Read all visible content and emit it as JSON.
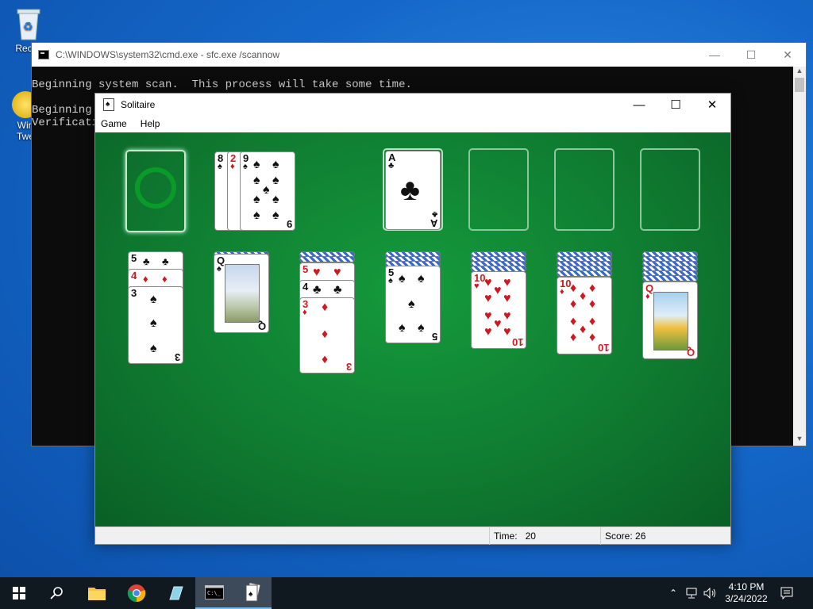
{
  "desktop": {
    "recycle_label": "Recyc",
    "tweaker_label_1": "Win",
    "tweaker_label_2": "Twe"
  },
  "cmd": {
    "title": "C:\\WINDOWS\\system32\\cmd.exe - sfc.exe /scannow",
    "lines": [
      "Beginning system scan.  This process will take some time.",
      "",
      "Beginning",
      "Verificati"
    ]
  },
  "solitaire": {
    "title": "Solitaire",
    "menu": [
      "Game",
      "Help"
    ],
    "status": {
      "time_label": "Time:",
      "time_value": "20",
      "score_label": "Score: 26"
    },
    "waste": [
      {
        "rank": "8",
        "suit": "♠",
        "color": "blk"
      },
      {
        "rank": "2",
        "suit": "♦",
        "color": "red"
      },
      {
        "rank": "9",
        "suit": "♠",
        "color": "blk"
      }
    ],
    "foundation": [
      {
        "rank": "A",
        "suit": "♣",
        "color": "blk"
      }
    ],
    "tableau": [
      {
        "cards": [
          {
            "rank": "5",
            "suit": "♣",
            "color": "blk"
          },
          {
            "rank": "4",
            "suit": "♦",
            "color": "red"
          },
          {
            "rank": "3",
            "suit": "♠",
            "color": "blk"
          }
        ]
      },
      {
        "cards": [
          {
            "rank": "Q",
            "suit": "♠",
            "color": "blk"
          }
        ]
      },
      {
        "cards": [
          {
            "rank": "5",
            "suit": "♥",
            "color": "red"
          },
          {
            "rank": "4",
            "suit": "♣",
            "color": "blk"
          },
          {
            "rank": "3",
            "suit": "♦",
            "color": "red"
          }
        ]
      },
      {
        "cards": [
          {
            "rank": "5",
            "suit": "♠",
            "color": "blk"
          }
        ]
      },
      {
        "cards": [
          {
            "rank": "10",
            "suit": "♥",
            "color": "red"
          }
        ]
      },
      {
        "cards": [
          {
            "rank": "10",
            "suit": "♦",
            "color": "red"
          }
        ]
      },
      {
        "cards": [
          {
            "rank": "Q",
            "suit": "♦",
            "color": "red"
          }
        ]
      }
    ]
  },
  "taskbar": {
    "time": "4:10 PM",
    "date": "3/24/2022"
  }
}
